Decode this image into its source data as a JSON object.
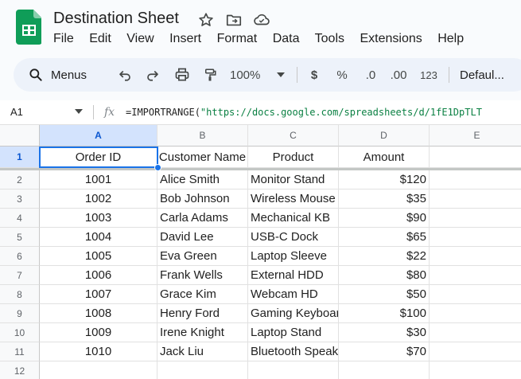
{
  "app": {
    "doc_title": "Destination Sheet",
    "menu": [
      "File",
      "Edit",
      "View",
      "Insert",
      "Format",
      "Data",
      "Tools",
      "Extensions",
      "Help"
    ]
  },
  "toolbar": {
    "search_label": "Menus",
    "zoom": "100%",
    "currency": "$",
    "percent": "%",
    "decrease_decimal": ".0",
    "increase_decimal": ".00",
    "number_format": "123",
    "font": "Defaul..."
  },
  "formula_bar": {
    "cell_ref": "A1",
    "fx": "fx",
    "formula_prefix": "=IMPORTRANGE(",
    "formula_string": "\"https://docs.google.com/spreadsheets/d/1fE1DpTLT"
  },
  "sheet": {
    "columns": [
      "A",
      "B",
      "C",
      "D",
      "E"
    ],
    "row_numbers": [
      "1",
      "2",
      "3",
      "4",
      "5",
      "6",
      "7",
      "8",
      "9",
      "10",
      "11",
      "12"
    ],
    "headers": [
      "Order ID",
      "Customer Name",
      "Product",
      "Amount"
    ],
    "rows": [
      [
        "1001",
        "Alice Smith",
        "Monitor Stand",
        "$120"
      ],
      [
        "1002",
        "Bob Johnson",
        "Wireless Mouse",
        "$35"
      ],
      [
        "1003",
        "Carla Adams",
        "Mechanical KB",
        "$90"
      ],
      [
        "1004",
        "David Lee",
        "USB-C Dock",
        "$65"
      ],
      [
        "1005",
        "Eva Green",
        "Laptop Sleeve",
        "$22"
      ],
      [
        "1006",
        "Frank Wells",
        "External HDD",
        "$80"
      ],
      [
        "1007",
        "Grace Kim",
        "Webcam HD",
        "$50"
      ],
      [
        "1008",
        "Henry Ford",
        "Gaming Keyboard",
        "$100"
      ],
      [
        "1009",
        "Irene Knight",
        "Laptop Stand",
        "$30"
      ],
      [
        "1010",
        "Jack Liu",
        "Bluetooth Speaker",
        "$70"
      ]
    ]
  },
  "colors": {
    "accent": "#1a73e8",
    "sheets_green": "#0f9d58",
    "selected_header": "#d3e3fd"
  }
}
